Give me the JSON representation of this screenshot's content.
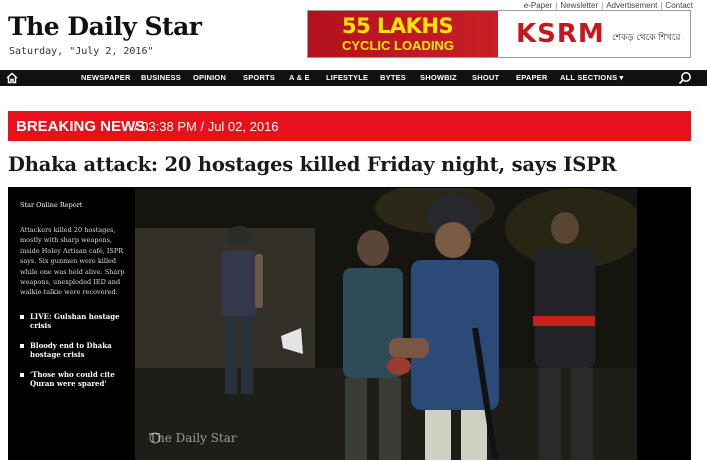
{
  "header": {
    "logo": "The Daily Star",
    "date": "Saturday, \"July 2, 2016\"",
    "top_links": [
      "e-Paper",
      "Newsletter",
      "Advertisement",
      "Contact"
    ]
  },
  "ad": {
    "headline": "55 LAKHS",
    "subline": "CYCLIC LOADING",
    "brand": "KSRM",
    "tagline": "শেকড় থেকে শিখরে"
  },
  "nav": {
    "items": [
      "NEWSPAPER",
      "BUSINESS",
      "OPINION",
      "SPORTS",
      "A & E",
      "LIFESTYLE",
      "BYTES",
      "SHOWBIZ",
      "SHOUT",
      "EPAPER",
      "ALL SECTIONS ▾"
    ]
  },
  "breaking": {
    "label": "BREAKING NEWS",
    "time": "/ 03:38 PM / Jul 02, 2016"
  },
  "article": {
    "headline": "Dhaka attack: 20 hostages killed Friday night, says ISPR",
    "byline": "Star Online Report",
    "summary": "Attackers killed 20 hostages, mostly with sharp weapons, inside Holey Artisan café, ISPR says. Six gunmen were killed while one was held alive. Sharp weapons, unexploded IED and walkie-talkie were recovered.",
    "related": [
      "LIVE: Gulshan hostage crisis",
      "Bloody end to Dhaka hostage crisis",
      "'Those who could cite Quran were spared'"
    ],
    "photo_watermark": "The Daily Star"
  },
  "colors": {
    "breaking_red": "#e8111a",
    "nav_bg": "#111111",
    "ad_red": "#c8161e",
    "ad_yellow": "#ffe600"
  }
}
